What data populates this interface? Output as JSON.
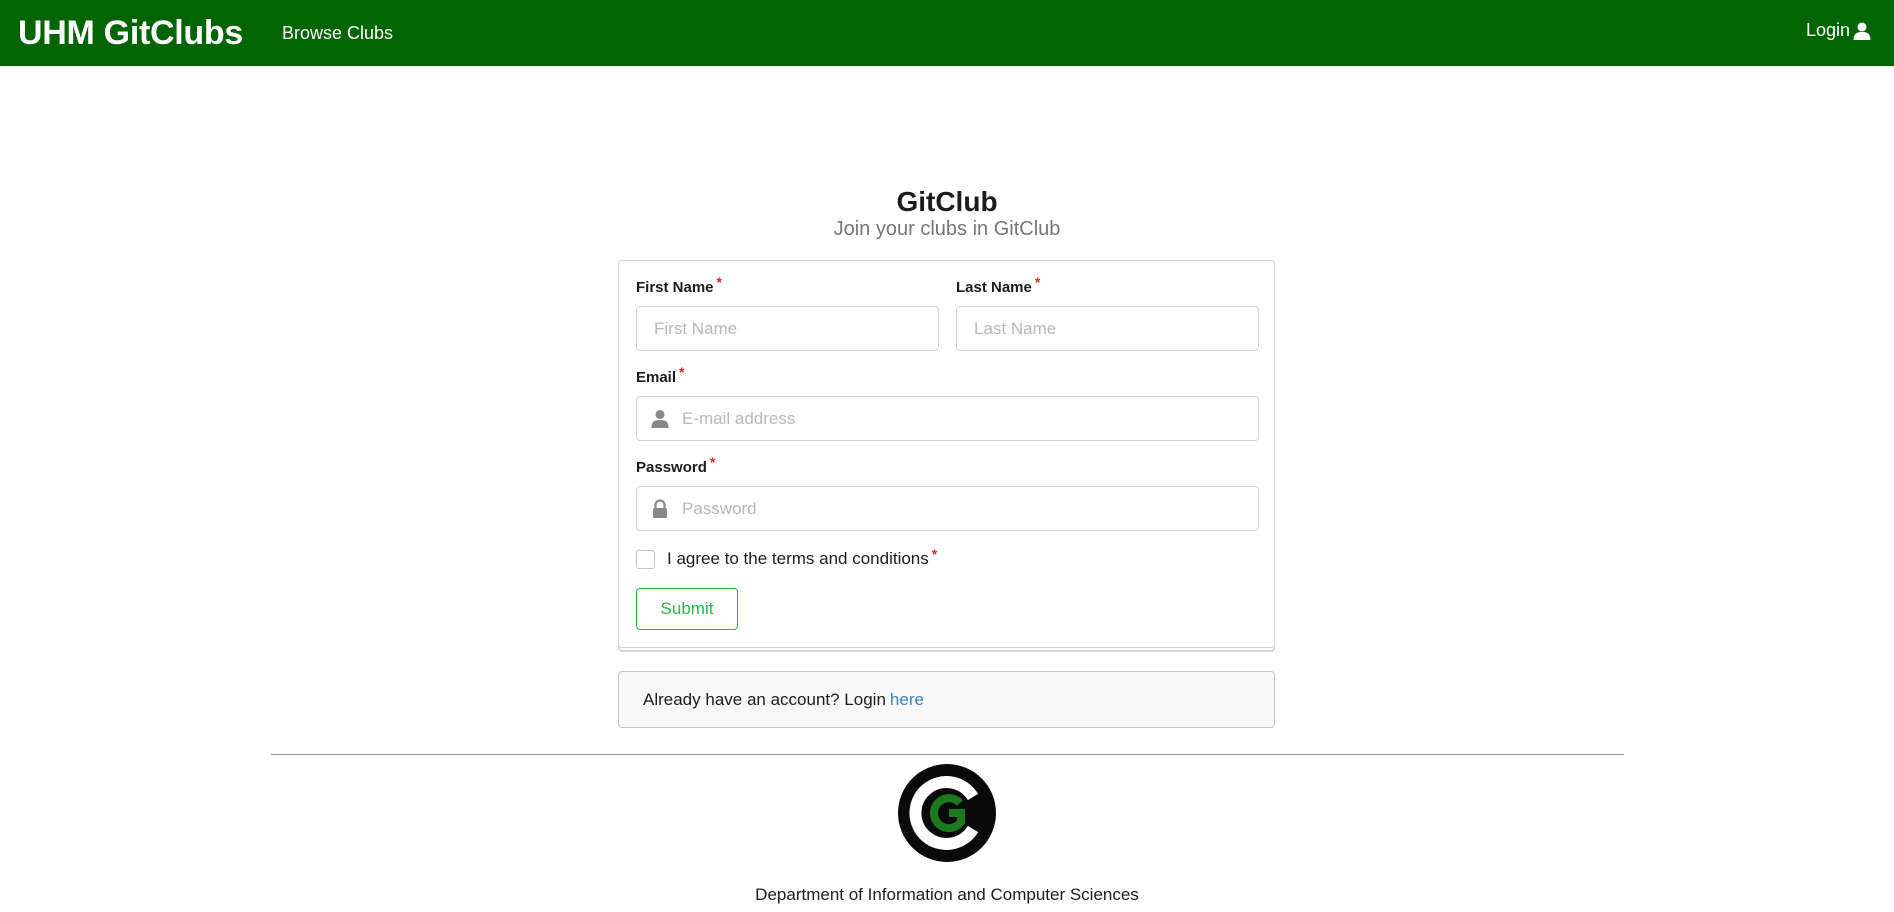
{
  "navbar": {
    "brand": "UHM GitClubs",
    "browse_clubs": "Browse Clubs",
    "login": "Login",
    "login_icon": "user-icon",
    "color": "#006400"
  },
  "header": {
    "title": "GitClub",
    "subtitle": "Join your clubs in GitClub"
  },
  "form": {
    "first_name": {
      "label": "First Name",
      "required": "*",
      "placeholder": "First Name"
    },
    "last_name": {
      "label": "Last Name",
      "required": "*",
      "placeholder": "Last Name"
    },
    "email": {
      "label": "Email",
      "required": "*",
      "placeholder": "E-mail address",
      "icon": "user-icon"
    },
    "password": {
      "label": "Password",
      "required": "*",
      "placeholder": "Password",
      "icon": "lock-icon"
    },
    "terms": {
      "label": "I agree to the terms and conditions",
      "required": "*",
      "checked": false
    },
    "submit_label": "Submit",
    "submit_color": "#21ba45"
  },
  "login_message": {
    "text": "Already have an account? Login",
    "link": "here",
    "link_color": "#4183c4"
  },
  "footer": {
    "logo_icon": "gitclub-logo",
    "text": "Department of Information and Computer Sciences"
  }
}
